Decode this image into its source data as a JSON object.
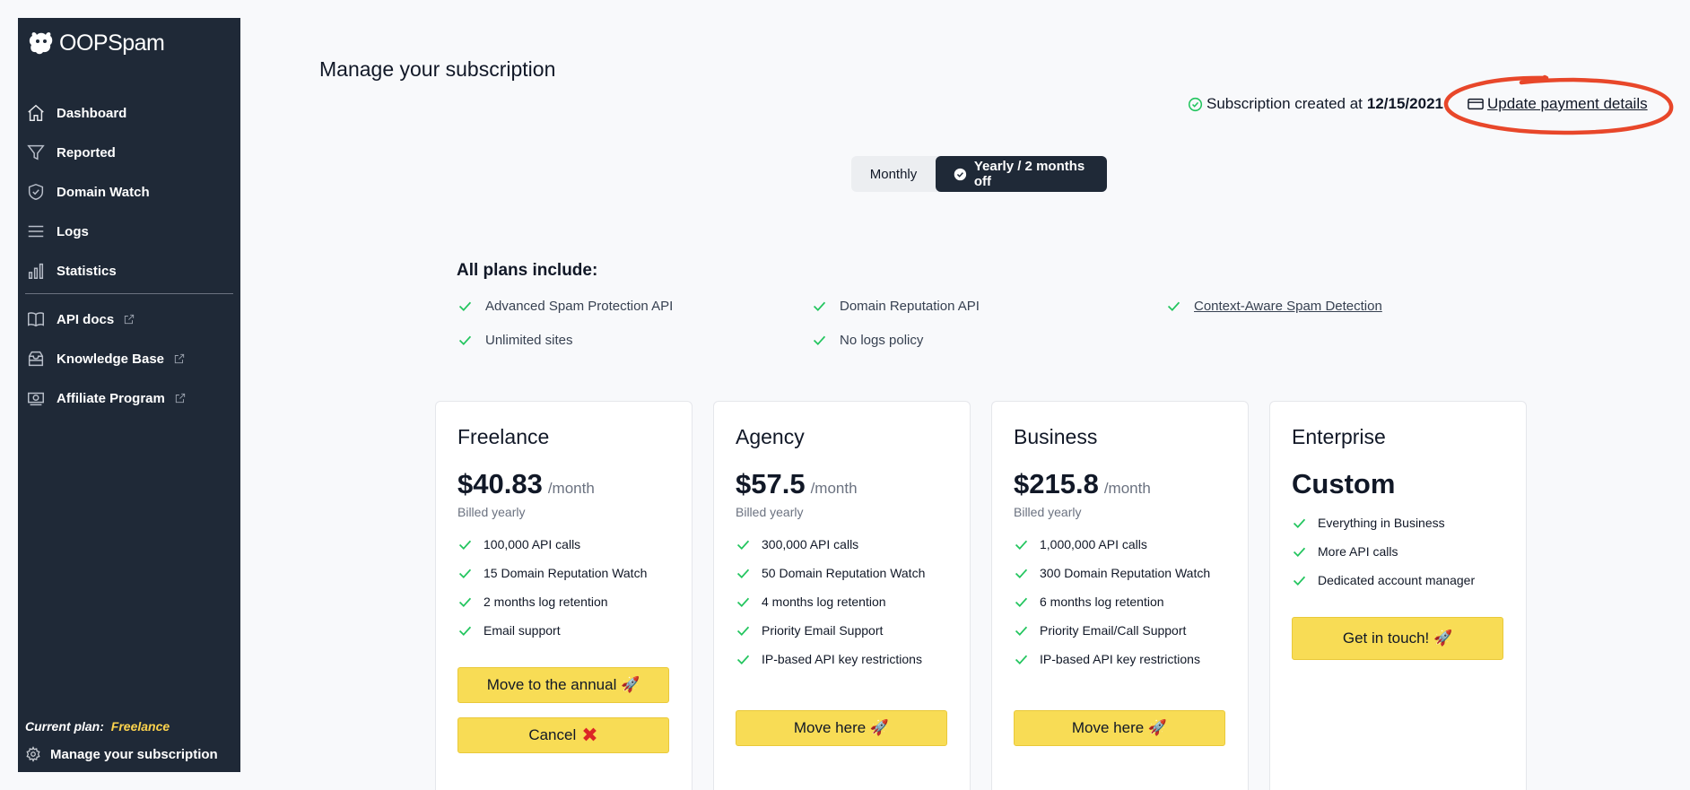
{
  "brand": {
    "name": "OOPSpam"
  },
  "sidebar": {
    "items": [
      {
        "label": "Dashboard",
        "icon": "home-icon"
      },
      {
        "label": "Reported",
        "icon": "funnel-icon"
      },
      {
        "label": "Domain Watch",
        "icon": "shield-check-icon"
      },
      {
        "label": "Logs",
        "icon": "menu-lines-icon"
      },
      {
        "label": "Statistics",
        "icon": "bar-chart-icon"
      }
    ],
    "external": [
      {
        "label": "API docs",
        "icon": "book-icon"
      },
      {
        "label": "Knowledge Base",
        "icon": "inbox-stack-icon"
      },
      {
        "label": "Affiliate Program",
        "icon": "cash-icon"
      }
    ],
    "current_plan_label": "Current plan:",
    "current_plan_name": "Freelance",
    "manage_label": "Manage your subscription"
  },
  "header": {
    "title": "Manage your subscription",
    "subscription_text": "Subscription created at",
    "subscription_date": "12/15/2021",
    "update_payment": "Update payment details"
  },
  "billing_toggle": {
    "monthly": "Monthly",
    "yearly": "Yearly / 2 months off",
    "selected": "yearly"
  },
  "features": {
    "title": "All plans include:",
    "items": [
      "Advanced Spam Protection API",
      "Domain Reputation API",
      "Context-Aware Spam Detection",
      "Unlimited sites",
      "No logs policy"
    ]
  },
  "plans": [
    {
      "name": "Freelance",
      "price": "$40.83",
      "period": "/month",
      "billed": "Billed yearly",
      "features": [
        "100,000 API calls",
        "15 Domain Reputation Watch",
        "2 months log retention",
        "Email support"
      ],
      "buttons": [
        "Move to the annual 🚀",
        "Cancel"
      ]
    },
    {
      "name": "Agency",
      "price": "$57.5",
      "period": "/month",
      "billed": "Billed yearly",
      "features": [
        "300,000 API calls",
        "50 Domain Reputation Watch",
        "4 months log retention",
        "Priority Email Support",
        "IP-based API key restrictions"
      ],
      "buttons": [
        "Move here 🚀"
      ]
    },
    {
      "name": "Business",
      "price": "$215.8",
      "period": "/month",
      "billed": "Billed yearly",
      "features": [
        "1,000,000 API calls",
        "300 Domain Reputation Watch",
        "6 months log retention",
        "Priority Email/Call Support",
        "IP-based API key restrictions"
      ],
      "buttons": [
        "Move here 🚀"
      ]
    },
    {
      "name": "Enterprise",
      "price": "Custom",
      "features": [
        "Everything in Business",
        "More API calls",
        "Dedicated account manager"
      ],
      "buttons": [
        "Get in touch! 🚀"
      ]
    }
  ],
  "colors": {
    "sidebar": "#1f2937",
    "accent_button": "#f8dc55",
    "check": "#22c55e",
    "annotation": "#e8472a"
  }
}
